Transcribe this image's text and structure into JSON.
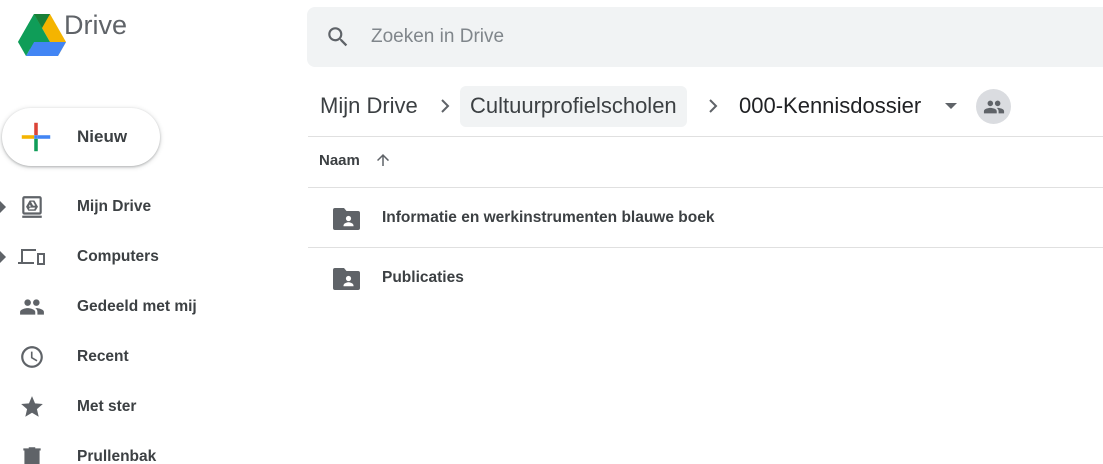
{
  "app": {
    "name": "Drive"
  },
  "search": {
    "placeholder": "Zoeken in Drive",
    "value": ""
  },
  "new_button": {
    "label": "Nieuw"
  },
  "sidebar": {
    "items": [
      {
        "label": "Mijn Drive",
        "icon": "my-drive-icon",
        "expandable": true
      },
      {
        "label": "Computers",
        "icon": "computers-icon",
        "expandable": true
      },
      {
        "label": "Gedeeld met mij",
        "icon": "shared-with-me-icon",
        "expandable": false
      },
      {
        "label": "Recent",
        "icon": "clock-icon",
        "expandable": false
      },
      {
        "label": "Met ster",
        "icon": "star-icon",
        "expandable": false
      },
      {
        "label": "Prullenbak",
        "icon": "trash-icon",
        "expandable": false
      }
    ]
  },
  "breadcrumb": {
    "root": "Mijn Drive",
    "parent": "Cultuurprofielscholen",
    "current": "000-Kennisdossier"
  },
  "list": {
    "column_name": "Naam",
    "sort": "ascending",
    "rows": [
      {
        "name": "Informatie en werkinstrumenten blauwe boek",
        "icon": "shared-folder-icon"
      },
      {
        "name": "Publicaties",
        "icon": "shared-folder-icon"
      }
    ]
  },
  "colors": {
    "icon_gray": "#5f6368",
    "text": "#3c4043",
    "search_bg": "#f1f3f4",
    "drive_green": "#0f9d58",
    "drive_yellow": "#f4b400",
    "drive_blue": "#4285f4",
    "drive_red": "#db4437"
  }
}
